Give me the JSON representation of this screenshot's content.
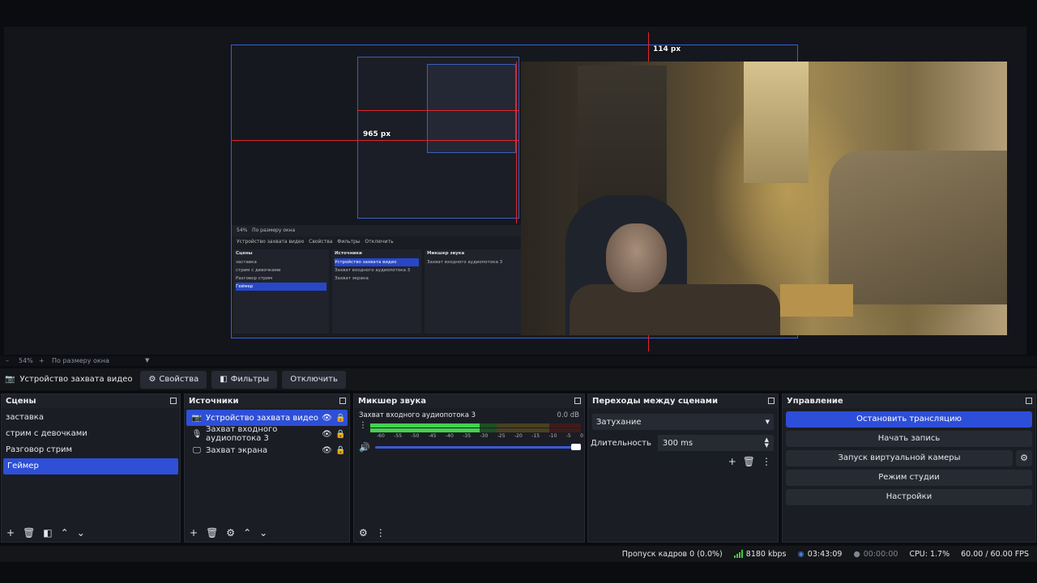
{
  "preview": {
    "measure_top": "114 px",
    "measure_left": "965 px"
  },
  "zoombar": {
    "minus": "–",
    "zoom": "54%",
    "plus": "+",
    "fit": "По размеру окна"
  },
  "source_toolbar": {
    "source_name": "Устройство захвата видео",
    "properties": "Свойства",
    "filters": "Фильтры",
    "deactivate": "Отключить"
  },
  "scenes": {
    "title": "Сцены",
    "items": [
      "заставка",
      "стрим с девочками",
      "Разговор стрим",
      "Геймер"
    ],
    "selected": "Геймер"
  },
  "sources": {
    "title": "Источники",
    "items": [
      {
        "label": "Устройство захвата видео",
        "icon": "camera-icon"
      },
      {
        "label": "Захват входного аудиопотока 3",
        "icon": "microphone-icon"
      },
      {
        "label": "Захват экрана",
        "icon": "monitor-icon"
      }
    ]
  },
  "mixer": {
    "title": "Микшер звука",
    "channel_name": "Захват входного аудиопотока 3",
    "channel_db": "0.0 dB",
    "scale": [
      "-60",
      "-55",
      "-50",
      "-45",
      "-40",
      "-35",
      "-30",
      "-25",
      "-20",
      "-15",
      "-10",
      "-5",
      "0"
    ],
    "volume_level": 1.0
  },
  "transitions": {
    "title": "Переходы между сценами",
    "selected": "Затухание",
    "duration_label": "Длительность",
    "duration_value": "300 ms"
  },
  "controls": {
    "title": "Управление",
    "stop_stream": "Остановить трансляцию",
    "start_record": "Начать запись",
    "virtual_cam": "Запуск виртуальной камеры",
    "studio_mode": "Режим студии",
    "settings": "Настройки"
  },
  "statusbar": {
    "dropped": "Пропуск кадров 0 (0.0%)",
    "bitrate": "8180 kbps",
    "stream_time": "03:43:09",
    "record_time": "00:00:00",
    "cpu": "CPU: 1.7%",
    "fps": "60.00 / 60.00 FPS"
  },
  "mini_obs": {
    "zoom": "54%",
    "fit": "По размеру окна",
    "source_name": "Устройство захвата видео",
    "properties": "Свойства",
    "filters": "Фильтры",
    "deactivate": "Отключить",
    "scenes_title": "Сцены",
    "sources_title": "Источники",
    "mixer_title": "Микшер звука",
    "mixer_channel": "Захват входного аудиопотока 3"
  },
  "colors": {
    "accent": "#2e4fd6",
    "measure_red": "#e0262b",
    "meter_green": "#43d14f"
  }
}
